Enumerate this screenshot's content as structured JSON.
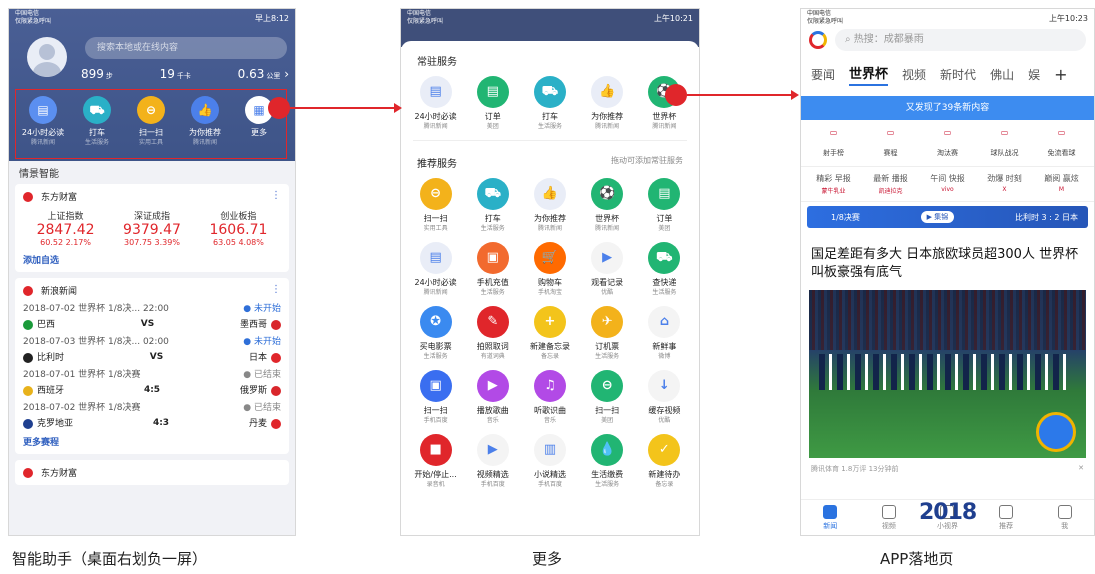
{
  "captions": {
    "left": "智能助手（桌面右划负一屏）",
    "middle": "更多",
    "right": "APP落地页"
  },
  "phone1": {
    "status": {
      "carrier": "中国电信",
      "carrier2": "仅限紧急呼叫",
      "time": "早上8:12"
    },
    "search_placeholder": "搜索本地或在线内容",
    "stats": {
      "steps": "899",
      "steps_unit": "步",
      "kcal": "19",
      "kcal_unit": "千卡",
      "km": "0.63",
      "km_unit": "公里"
    },
    "quick_items": [
      {
        "label": "24小时必读",
        "sub": "腾讯新闻",
        "icon": "news-icon",
        "color": "#5b8ff0",
        "glyph": "▤"
      },
      {
        "label": "打车",
        "sub": "生活服务",
        "icon": "taxi-icon",
        "color": "#2ab0c7",
        "glyph": "⛟"
      },
      {
        "label": "扫一扫",
        "sub": "实用工具",
        "icon": "scan-icon",
        "color": "#f3b21b",
        "glyph": "⊖"
      },
      {
        "label": "为你推荐",
        "sub": "腾讯新闻",
        "icon": "thumbs-up-icon",
        "color": "#4c80ea",
        "glyph": "👍"
      },
      {
        "label": "更多",
        "sub": "",
        "icon": "grid-icon",
        "color": "#ffffff",
        "glyph": "▦"
      }
    ],
    "section_title": "情景智能",
    "stock_card": {
      "title": "东方财富",
      "stocks": [
        {
          "name": "上证指数",
          "value": "2847.42",
          "delta": "60.52  2.17%"
        },
        {
          "name": "深证成指",
          "value": "9379.47",
          "delta": "307.75  3.39%"
        },
        {
          "name": "创业板指",
          "value": "1606.71",
          "delta": "63.05  4.08%"
        }
      ],
      "link": "添加自选"
    },
    "news_card": {
      "title": "新浪新闻",
      "matches": [
        {
          "date": "2018-07-02 世界杯 1/8决... 22:00",
          "status": "未开始",
          "home": "巴西",
          "score": "VS",
          "away": "墨西哥"
        },
        {
          "date": "2018-07-03 世界杯 1/8决... 02:00",
          "status": "未开始",
          "home": "比利时",
          "score": "VS",
          "away": "日本"
        },
        {
          "date": "2018-07-01 世界杯 1/8决赛",
          "status": "已结束",
          "home": "西班牙",
          "score": "4:5",
          "away": "俄罗斯"
        },
        {
          "date": "2018-07-02 世界杯 1/8决赛",
          "status": "已结束",
          "home": "克罗地亚",
          "score": "4:3",
          "away": "丹麦"
        }
      ],
      "link": "更多赛程"
    },
    "bottom_card_title": "东方财富"
  },
  "phone2": {
    "status": {
      "carrier": "中国电信",
      "carrier2": "仅限紧急呼叫",
      "time": "上午10:21"
    },
    "frequent_title": "常驻服务",
    "frequent": [
      {
        "label": "24小时必读",
        "sub": "腾讯新闻",
        "color": "#e9edf7",
        "fg": "#4c80ea",
        "glyph": "▤"
      },
      {
        "label": "订单",
        "sub": "美团",
        "color": "#21b573",
        "fg": "#fff",
        "glyph": "▤"
      },
      {
        "label": "打车",
        "sub": "生活服务",
        "color": "#2ab0c7",
        "fg": "#fff",
        "glyph": "⛟"
      },
      {
        "label": "为你推荐",
        "sub": "腾讯新闻",
        "color": "#e9edf7",
        "fg": "#4c80ea",
        "glyph": "👍"
      },
      {
        "label": "世界杯",
        "sub": "腾讯新闻",
        "color": "#21b573",
        "fg": "#fff",
        "glyph": "⚽"
      }
    ],
    "recommended_title": "推荐服务",
    "recommended_hint": "拖动可添加常驻服务",
    "recommended": [
      {
        "label": "扫一扫",
        "sub": "实用工具",
        "color": "#f3b21b",
        "glyph": "⊖"
      },
      {
        "label": "打车",
        "sub": "生活服务",
        "color": "#2ab0c7",
        "glyph": "⛟"
      },
      {
        "label": "为你推荐",
        "sub": "腾讯新闻",
        "color": "#e9edf7",
        "glyph": "👍"
      },
      {
        "label": "世界杯",
        "sub": "腾讯新闻",
        "color": "#21b573",
        "glyph": "⚽"
      },
      {
        "label": "订单",
        "sub": "美团",
        "color": "#21b573",
        "glyph": "▤"
      },
      {
        "label": "24小时必读",
        "sub": "腾讯新闻",
        "color": "#e9edf7",
        "glyph": "▤"
      },
      {
        "label": "手机充值",
        "sub": "生活服务",
        "color": "#f26a2e",
        "glyph": "▣"
      },
      {
        "label": "购物车",
        "sub": "手机淘宝",
        "color": "#ff6a00",
        "glyph": "🛒"
      },
      {
        "label": "观看记录",
        "sub": "优酷",
        "color": "#f4f4f4",
        "glyph": "▶"
      },
      {
        "label": "查快递",
        "sub": "生活服务",
        "color": "#21b573",
        "glyph": "⛟"
      },
      {
        "label": "买电影票",
        "sub": "生活服务",
        "color": "#3a8af0",
        "glyph": "✪"
      },
      {
        "label": "拍照取词",
        "sub": "有道词典",
        "color": "#e0262b",
        "glyph": "✎"
      },
      {
        "label": "新建备忘录",
        "sub": "备忘录",
        "color": "#f3c41b",
        "glyph": "+"
      },
      {
        "label": "订机票",
        "sub": "生活服务",
        "color": "#f3b21b",
        "glyph": "✈"
      },
      {
        "label": "新鲜事",
        "sub": "微博",
        "color": "#f4f4f4",
        "glyph": "⌂"
      },
      {
        "label": "扫一扫",
        "sub": "手机百度",
        "color": "#3a6ef0",
        "glyph": "▣"
      },
      {
        "label": "播放歌曲",
        "sub": "音乐",
        "color": "#b24ae6",
        "glyph": "▶"
      },
      {
        "label": "听歌识曲",
        "sub": "音乐",
        "color": "#b24ae6",
        "glyph": "♫"
      },
      {
        "label": "扫一扫",
        "sub": "美团",
        "color": "#21b573",
        "glyph": "⊖"
      },
      {
        "label": "缓存视频",
        "sub": "优酷",
        "color": "#f4f4f4",
        "glyph": "↓"
      },
      {
        "label": "开始/停止...",
        "sub": "录音机",
        "color": "#e0262b",
        "glyph": "■"
      },
      {
        "label": "视频精选",
        "sub": "手机百度",
        "color": "#f4f4f4",
        "glyph": "▶"
      },
      {
        "label": "小说精选",
        "sub": "手机百度",
        "color": "#f4f4f4",
        "glyph": "▥"
      },
      {
        "label": "生活缴费",
        "sub": "生活服务",
        "color": "#21b573",
        "glyph": "💧"
      },
      {
        "label": "新建待办",
        "sub": "备忘录",
        "color": "#f3c41b",
        "glyph": "✓"
      }
    ]
  },
  "phone3": {
    "status": {
      "carrier": "中国电信",
      "carrier2": "仅限紧急呼叫",
      "time": "上午10:23"
    },
    "search_placeholder": "热搜：成都暴雨",
    "tabs": [
      "要闻",
      "世界杯",
      "视频",
      "新时代",
      "佛山",
      "娱"
    ],
    "active_tab": "世界杯",
    "refresh_banner": "又发现了39条新内容",
    "icon_row": [
      {
        "logo": "射手榜",
        "label": "射手榜"
      },
      {
        "logo": "赛程",
        "label": "赛程"
      },
      {
        "logo": "淘汰赛",
        "label": "淘汰赛"
      },
      {
        "logo": "球队战况",
        "label": "球队战况"
      },
      {
        "logo": "免流看球",
        "label": "免流看球"
      }
    ],
    "schedule": [
      {
        "label": "精彩 早报",
        "sub": "蒙牛乳业"
      },
      {
        "label": "最新 播报",
        "sub": "凯迪拉克"
      },
      {
        "label": "午间 快报",
        "sub": "vivo"
      },
      {
        "label": "劲爆 时刻",
        "sub": "X"
      },
      {
        "label": "巅阅 赢炫",
        "sub": "M"
      }
    ],
    "live_bar": {
      "round": "1/8决赛",
      "pill": "集锦",
      "score": "比利时 3 : 2 日本"
    },
    "headline": "国足差距有多大 日本旅欧球员超300人 世界杯叫板豪强有底气",
    "meta": {
      "source": "腾讯体育  1.8万评  13分钟前",
      "close": "✕"
    },
    "wc_logo": "2018",
    "nav": [
      {
        "label": "新闻",
        "active": true
      },
      {
        "label": "视频",
        "active": false
      },
      {
        "label": "小视界",
        "active": false
      },
      {
        "label": "推荐",
        "active": false
      },
      {
        "label": "我",
        "active": false
      }
    ]
  }
}
